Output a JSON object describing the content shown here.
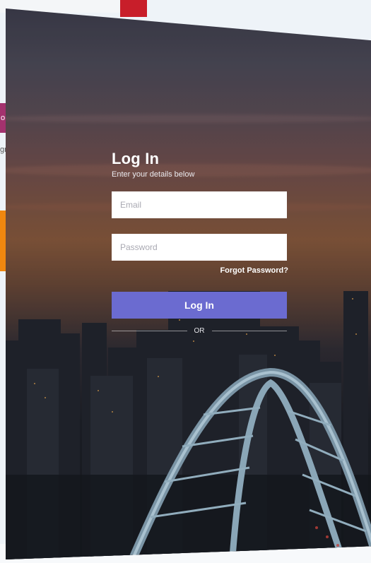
{
  "background_app": {
    "magenta_tab_fragment": "o",
    "text_fragment": "gr"
  },
  "login": {
    "title": "Log In",
    "subtitle": "Enter your details below",
    "email_placeholder": "Email",
    "email_value": "",
    "password_placeholder": "Password",
    "password_value": "",
    "forgot_label": "Forgot Password?",
    "button_label": "Log In",
    "divider_label": "OR"
  },
  "colors": {
    "button": "#6b6bd0",
    "input_bg": "#ffffff",
    "text": "#ffffff"
  },
  "background_image": "city-skyline-arch-bridge-sunset"
}
